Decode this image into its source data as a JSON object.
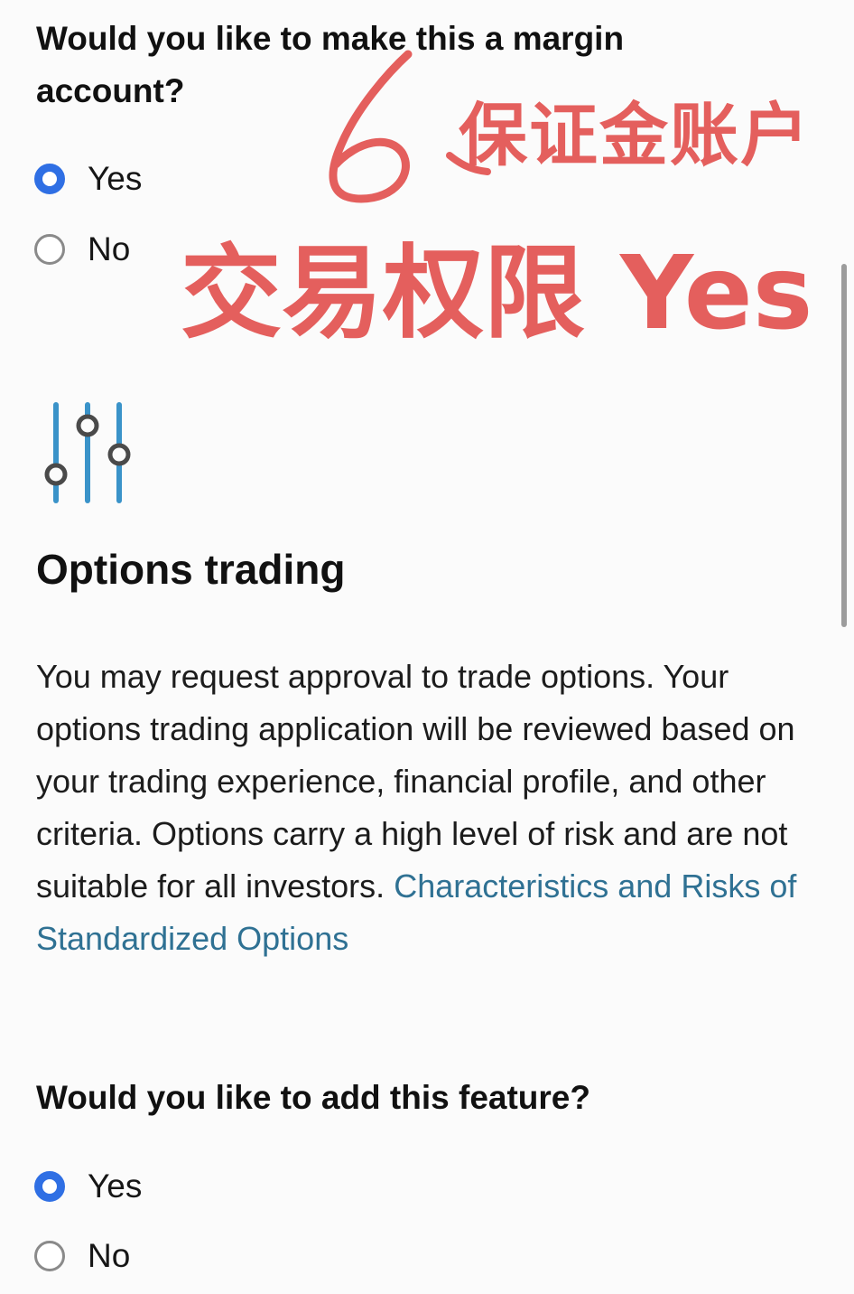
{
  "margin_section": {
    "question": "Would you like to make this a margin account?",
    "options": [
      {
        "label": "Yes",
        "selected": true
      },
      {
        "label": "No",
        "selected": false
      }
    ]
  },
  "options_section": {
    "icon": "sliders-icon",
    "title": "Options trading",
    "description": "You may request approval to trade options. Your options trading application will be reviewed based on your trading experience, financial profile, and other criteria. Options carry a high level of risk and are not suitable for all investors.",
    "link_text": "Characteristics and Risks of Standardized Options",
    "feature_question": "Would you like to add this feature?",
    "options": [
      {
        "label": "Yes",
        "selected": true
      },
      {
        "label": "No",
        "selected": false
      }
    ]
  },
  "annotations": {
    "step_number": "6",
    "margin_note": "保证金账户",
    "trading_note": "交易权限 Yes",
    "color": "#e45f5d"
  },
  "colors": {
    "radio_selected": "#2f6fe4",
    "link": "#2f7193",
    "icon_line": "#3a93c9",
    "icon_knob": "#4a4a4a"
  }
}
